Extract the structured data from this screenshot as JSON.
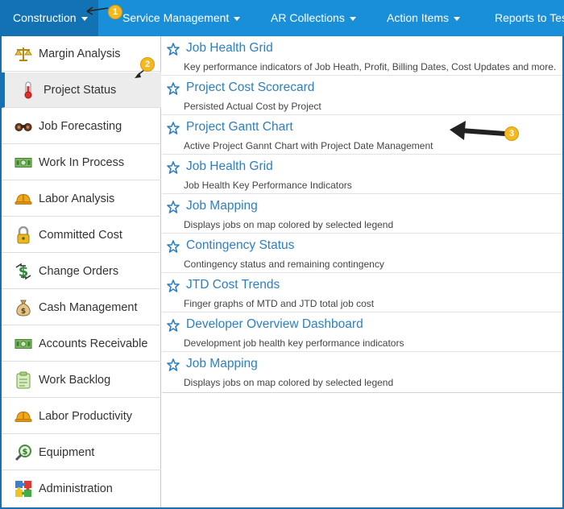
{
  "topnav": {
    "items": [
      {
        "label": "Construction",
        "has_caret": true
      },
      {
        "label": "Service Management",
        "has_caret": true
      },
      {
        "label": "AR Collections",
        "has_caret": true
      },
      {
        "label": "Action Items",
        "has_caret": true
      },
      {
        "label": "Reports to Tes",
        "has_caret": false
      }
    ]
  },
  "sidebar": {
    "items": [
      {
        "label": "Margin Analysis",
        "icon": "scales-icon"
      },
      {
        "label": "Project Status",
        "icon": "thermometer-icon",
        "active": true
      },
      {
        "label": "Job Forecasting",
        "icon": "binoculars-icon"
      },
      {
        "label": "Work In Process",
        "icon": "money-icon"
      },
      {
        "label": "Labor Analysis",
        "icon": "hardhat-icon"
      },
      {
        "label": "Committed Cost",
        "icon": "lock-icon"
      },
      {
        "label": "Change Orders",
        "icon": "dollar-arrows-icon"
      },
      {
        "label": "Cash Management",
        "icon": "money-bag-icon"
      },
      {
        "label": "Accounts Receivable",
        "icon": "money-icon"
      },
      {
        "label": "Work Backlog",
        "icon": "clipboard-icon"
      },
      {
        "label": "Labor Productivity",
        "icon": "hardhat-icon"
      },
      {
        "label": "Equipment",
        "icon": "magnifier-dollar-icon"
      },
      {
        "label": "Administration",
        "icon": "puzzle-icon"
      }
    ]
  },
  "reports": [
    {
      "title": "Job Health Grid",
      "description": "Key performance indicators of Job Heath, Profit, Billing Dates, Cost Updates and more."
    },
    {
      "title": "Project Cost Scorecard",
      "description": "Persisted Actual Cost by Project"
    },
    {
      "title": "Project Gantt Chart",
      "description": "Active Project Gannt Chart with Project Date Management"
    },
    {
      "title": "Job Health Grid",
      "description": "Job Health Key Performance Indicators"
    },
    {
      "title": "Job Mapping",
      "description": "Displays jobs on map colored by selected legend"
    },
    {
      "title": "Contingency Status",
      "description": "Contingency status and remaining contingency"
    },
    {
      "title": "JTD Cost Trends",
      "description": "Finger graphs of MTD and JTD total job cost"
    },
    {
      "title": "Developer Overview Dashboard",
      "description": "Development job health key performance indicators"
    },
    {
      "title": "Job Mapping",
      "description": "Displays jobs on map colored by selected legend"
    }
  ],
  "callouts": [
    {
      "number": "1"
    },
    {
      "number": "2"
    },
    {
      "number": "3"
    }
  ],
  "colors": {
    "nav_bg": "#1a8fd9",
    "nav_active": "#1372b4",
    "link": "#2d7fc1",
    "badge": "#f5b81e"
  }
}
